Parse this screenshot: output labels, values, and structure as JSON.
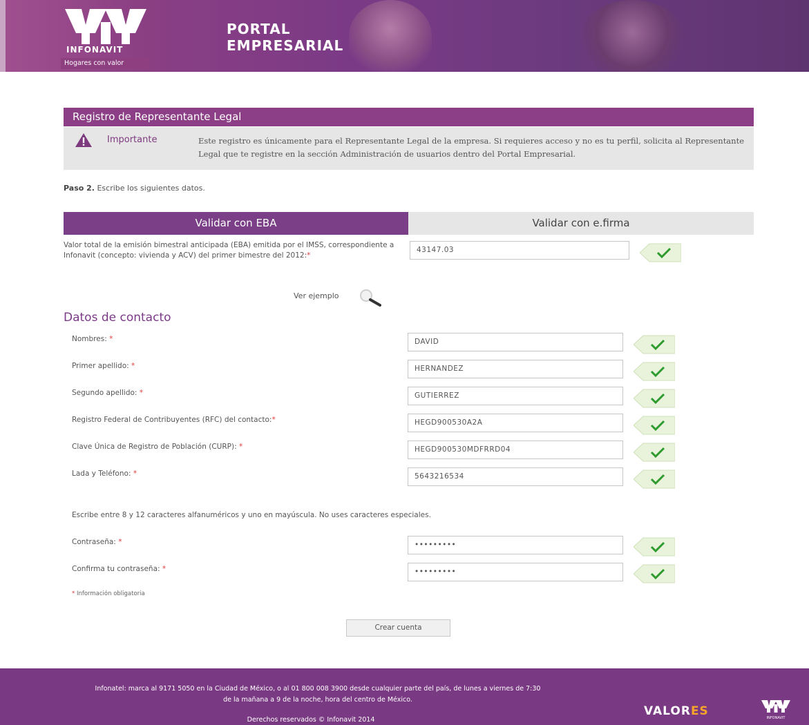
{
  "header": {
    "brand": "INFONAVIT",
    "tagline": "Hogares con valor",
    "portal_line1": "PORTAL",
    "portal_line2": "EMPRESARIAL"
  },
  "section": {
    "title": "Registro de Representante Legal"
  },
  "notice": {
    "label": "Importante",
    "text": "Este registro es únicamente para el Representante Legal de la empresa. Si requieres acceso y no es tu perfil, solicita al Representante Legal que te registre en la sección Administración de usuarios dentro del Portal Empresarial."
  },
  "step": {
    "bold": "Paso 2.",
    "text": " Escribe los siguientes datos."
  },
  "tabs": {
    "eba": "Validar con EBA",
    "firma": "Validar con e.firma"
  },
  "eba": {
    "label": "Valor total de la emisión bimestral anticipada (EBA) emitida por el IMSS, correspondiente a Infonavit (concepto: vivienda y ACV) del primer bimestre del 2012:",
    "value": "43147.03",
    "example_link": "Ver ejemplo"
  },
  "contact": {
    "title": "Datos de contacto",
    "fields": [
      {
        "label": "Nombres:",
        "value": "DAVID"
      },
      {
        "label": "Primer apellido:",
        "value": "HERNANDEZ"
      },
      {
        "label": "Segundo apellido:",
        "value": "GUTIERREZ"
      },
      {
        "label": "Registro Federal de Contribuyentes (RFC) del contacto:",
        "value": "HEGD900530A2A"
      },
      {
        "label": "Clave Única de Registro de Población (CURP):",
        "value": "HEGD900530MDFRRD04"
      },
      {
        "label": "Lada y Teléfono:",
        "value": "5643216534"
      }
    ],
    "password_hint": "Escribe entre 8 y 12 caracteres alfanuméricos y uno en mayúscula. No uses caracteres especiales.",
    "password_label": "Contraseña:",
    "password_value": "•••••••••",
    "confirm_label": "Confirma tu contraseña:",
    "confirm_value": "•••••••••",
    "required_star": "*",
    "mandatory_note": "Información obligatoria",
    "create_button": "Crear cuenta"
  },
  "footer": {
    "info_line1": "Infonatel: marca al 9171 5050 en la Ciudad de México, o al 01 800 008 3900 desde cualquier parte del país, de lunes a viernes de 7:30",
    "info_line2": "de la mañana a 9 de la noche, hora del centro de México.",
    "copyright": "Derechos reservados © Infonavit 2014",
    "valores_a": "VALOR",
    "valores_b": "ES",
    "mini_brand": "INFONAVIT"
  },
  "colors": {
    "brand_purple": "#8c3f86",
    "tab_active": "#7a3f86",
    "required": "#e23b3b",
    "check_green": "#2e9b2e",
    "valores_orange": "#f6a52a"
  }
}
